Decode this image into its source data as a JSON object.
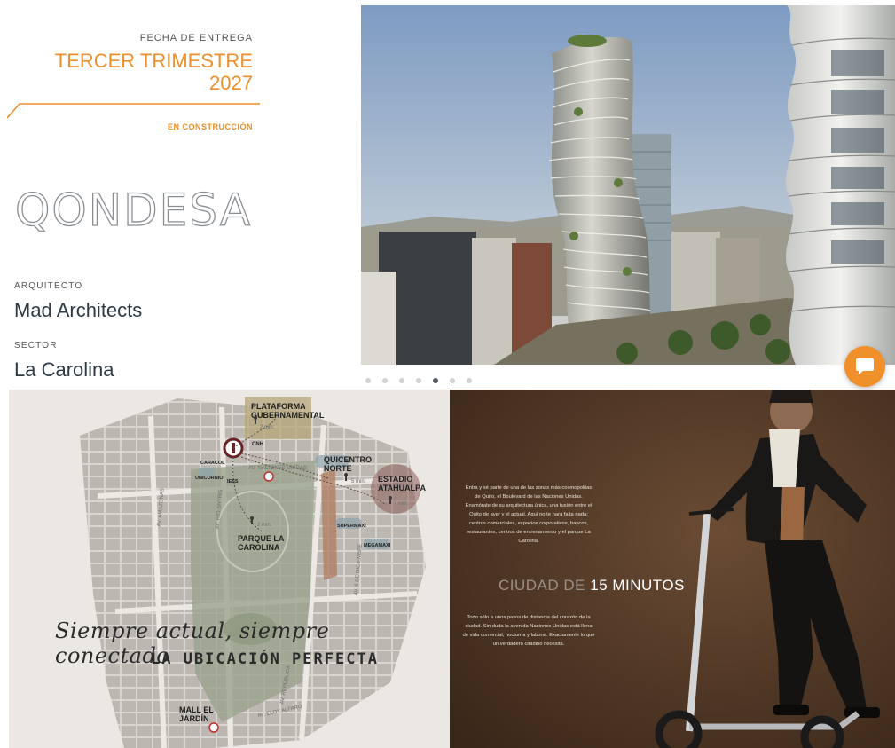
{
  "delivery": {
    "label": "FECHA DE ENTREGA",
    "value": "TERCER TRIMESTRE 2027",
    "status": "EN CONSTRUCCIÓN"
  },
  "project": {
    "name": "QONDESA"
  },
  "architect": {
    "label": "ARQUITECTO",
    "value": "Mad Architects"
  },
  "sector": {
    "label": "SECTOR",
    "value": "La Carolina"
  },
  "carousel": {
    "slide_count": 7,
    "active_index": 4
  },
  "map": {
    "script_text": "Siempre actual, siempre conectado",
    "headline": "LA UBICACIÓN PERFECTA",
    "places": {
      "plataforma": "PLATAFORMA GUBERNAMENTAL",
      "quicentro": "QUICENTRO NORTE",
      "estadio": "ESTADIO ATAHUALPA",
      "parque": "PARQUE LA CAROLINA",
      "mall": "MALL EL JARDÍN"
    },
    "distances": {
      "plataforma": "2 min.",
      "quicentro": "5 min.",
      "estadio": "7 min.",
      "parque": "2 min."
    },
    "small_labels": {
      "cnh": "CNH",
      "caracol": "CARACOL",
      "unicornio": "UNICORNIO",
      "iess": "IESS",
      "supermaxi": "SUPERMAXI",
      "megamaxi": "MEGAMAXI"
    },
    "streets": {
      "naciones_unidas": "AV. NACIONES UNIDAS",
      "amazonas": "AV. AMAZONAS",
      "shyris": "AV. RÍO SHYRIS",
      "diciembre": "AV. 6 DE DICIEMBRE",
      "eloy": "AV. ELOY ALFARO",
      "republica": "AV. REPÚBLICA"
    }
  },
  "city": {
    "intro": "Entra y sé parte de una de las zonas más cosmopolitas de Quito, el Boulevard de las Naciones Unidas. Enamórate de su arquitectura única, una fusión entre el Quito de ayer y el actual. Aquí no te hará falta nada: centros comerciales, espacios corporativos, bancos, restaurantes, centros de entrenamiento y el parque La Carolina.",
    "heading_light": "CIUDAD DE",
    "heading_bold": "15 MINUTOS",
    "body": "Todo sólo a unos pasos de distancia del corazón de la ciudad. Sin duda la avenida Naciones Unidas está llena de vida comercial, nocturna y laboral. Exactamente lo que un verdadero citadino necesita."
  },
  "colors": {
    "accent": "#ee8f2c",
    "chat_button": "#f0902a"
  },
  "icons": {
    "chat": "chat-bubble-icon",
    "pin": "map-pin-icon",
    "walker": "walking-person-icon",
    "metro": "metro-icon"
  }
}
